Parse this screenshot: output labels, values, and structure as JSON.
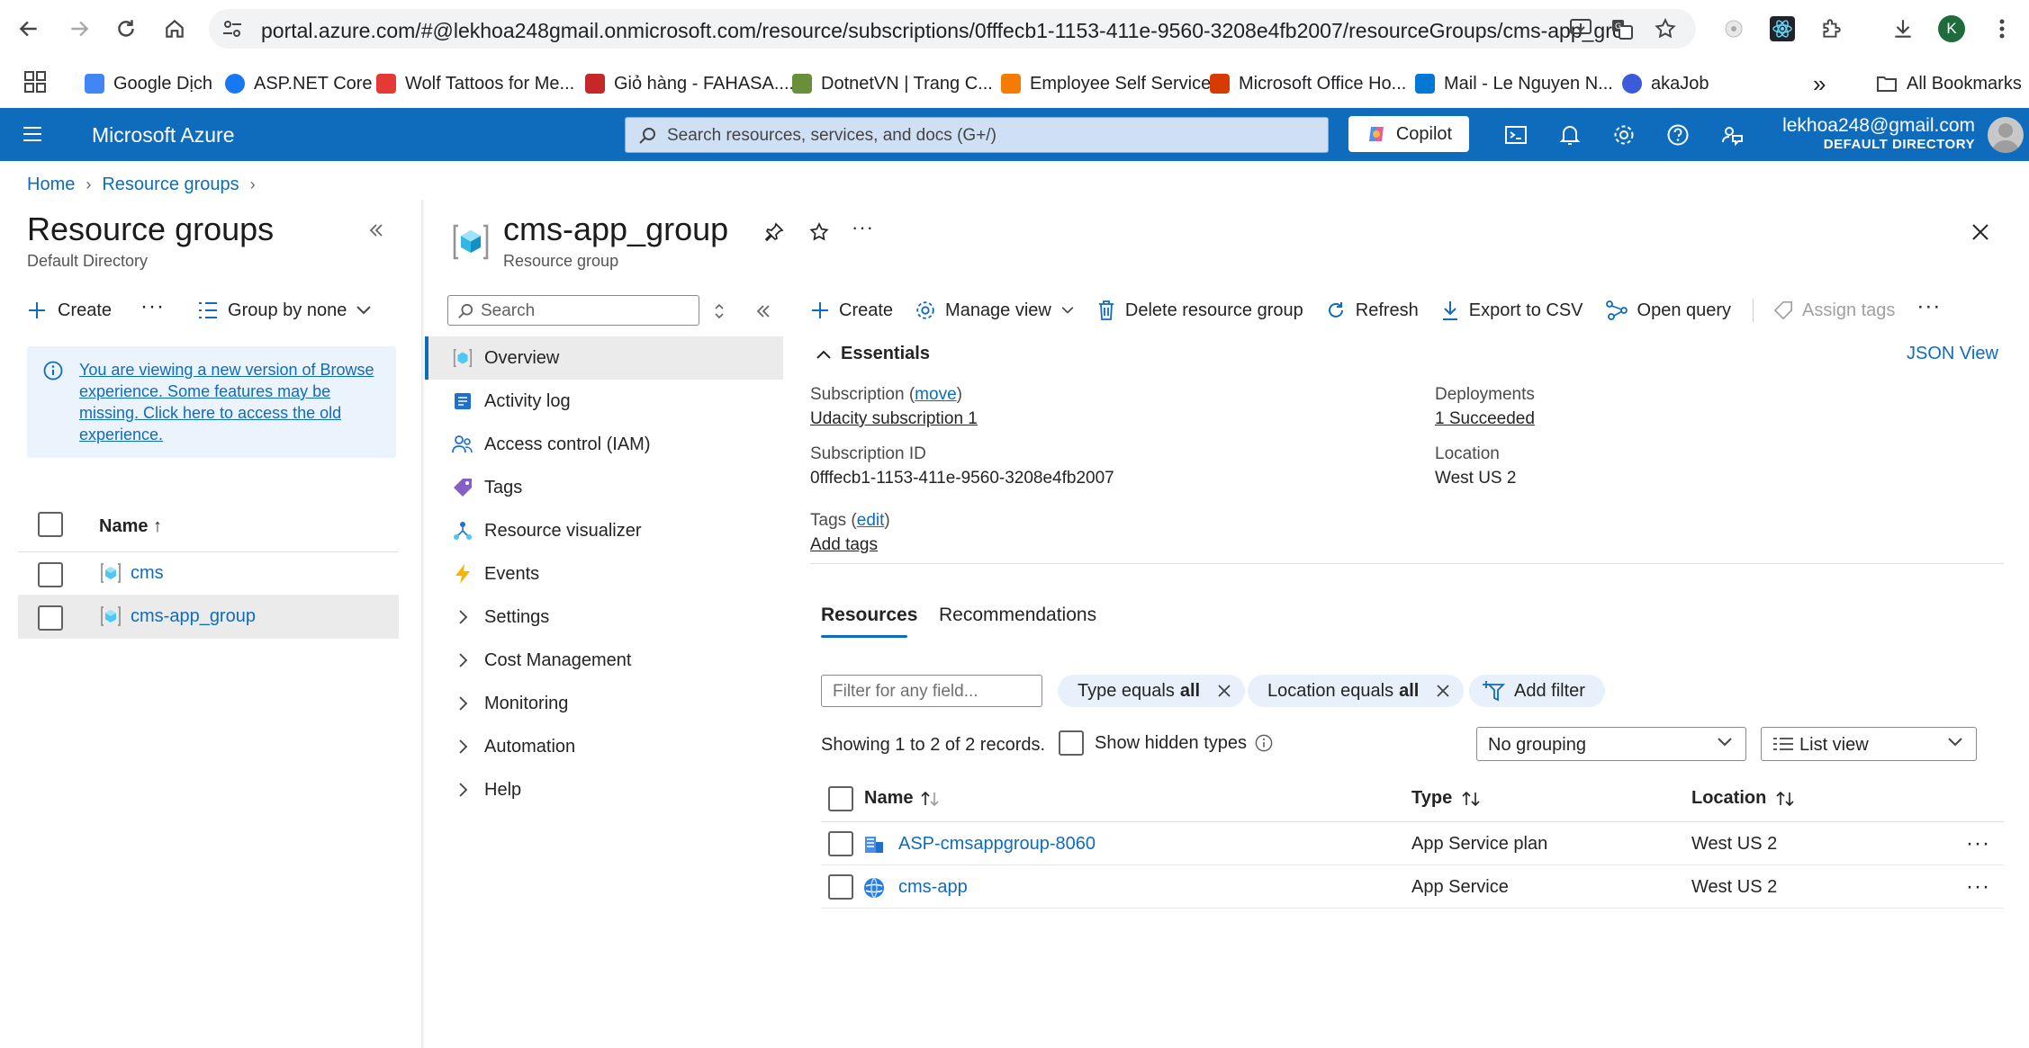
{
  "browser": {
    "url": "portal.azure.com/#@lekhoa248gmail.onmicrosoft.com/resource/subscriptions/0fffecb1-1153-411e-9560-3208e4fb2007/resourceGroups/cms-app_group...",
    "profile_initial": "K",
    "bookmarks": [
      "Google Dịch",
      "ASP.NET Core",
      "Wolf Tattoos for Me...",
      "Giỏ hàng - FAHASA....",
      "DotnetVN | Trang C...",
      "Employee Self Service",
      "Microsoft Office Ho...",
      "Mail - Le Nguyen N...",
      "akaJob"
    ],
    "more_bookmarks": "»",
    "all_bookmarks": "All Bookmarks"
  },
  "azure": {
    "brand": "Microsoft Azure",
    "search_placeholder": "Search resources, services, and docs (G+/)",
    "copilot": "Copilot",
    "account_email": "lekhoa248@gmail.com",
    "account_dir": "DEFAULT DIRECTORY"
  },
  "breadcrumb": [
    "Home",
    "Resource groups"
  ],
  "left": {
    "title": "Resource groups",
    "subtitle": "Default Directory",
    "create": "Create",
    "group_by": "Group by none",
    "info": "You are viewing a new version of Browse experience. Some features may be missing. Click here to access the old experience.",
    "name_header": "Name ↑",
    "items": [
      "cms",
      "cms-app_group"
    ]
  },
  "rg": {
    "title": "cms-app_group",
    "subtitle": "Resource group",
    "menu_search": "Search",
    "menu": [
      "Overview",
      "Activity log",
      "Access control (IAM)",
      "Tags",
      "Resource visualizer",
      "Events",
      "Settings",
      "Cost Management",
      "Monitoring",
      "Automation",
      "Help"
    ]
  },
  "commands": {
    "create": "Create",
    "manage_view": "Manage view",
    "delete": "Delete resource group",
    "refresh": "Refresh",
    "export": "Export to CSV",
    "open_query": "Open query",
    "assign_tags": "Assign tags"
  },
  "essentials": {
    "heading": "Essentials",
    "json_view": "JSON View",
    "subscription_label": "Subscription",
    "move": "move",
    "subscription_value": "Udacity subscription 1",
    "subscription_id_label": "Subscription ID",
    "subscription_id": "0fffecb1-1153-411e-9560-3208e4fb2007",
    "tags_label": "Tags",
    "edit": "edit",
    "add_tags": "Add tags",
    "deployments_label": "Deployments",
    "deployments_value": "1 Succeeded",
    "location_label": "Location",
    "location_value": "West US 2"
  },
  "tabs": [
    "Resources",
    "Recommendations"
  ],
  "filters": {
    "placeholder": "Filter for any field...",
    "type_pill": "Type equals",
    "location_pill": "Location equals",
    "all": "all",
    "add_filter": "Add filter"
  },
  "list": {
    "showing": "Showing 1 to 2 of 2 records.",
    "show_hidden": "Show hidden types",
    "grouping": "No grouping",
    "view": "List view",
    "headers": {
      "name": "Name",
      "type": "Type",
      "location": "Location"
    },
    "rows": [
      {
        "name": "ASP-cmsappgroup-8060",
        "type": "App Service plan",
        "location": "West US 2"
      },
      {
        "name": "cms-app",
        "type": "App Service",
        "location": "West US 2"
      }
    ]
  }
}
